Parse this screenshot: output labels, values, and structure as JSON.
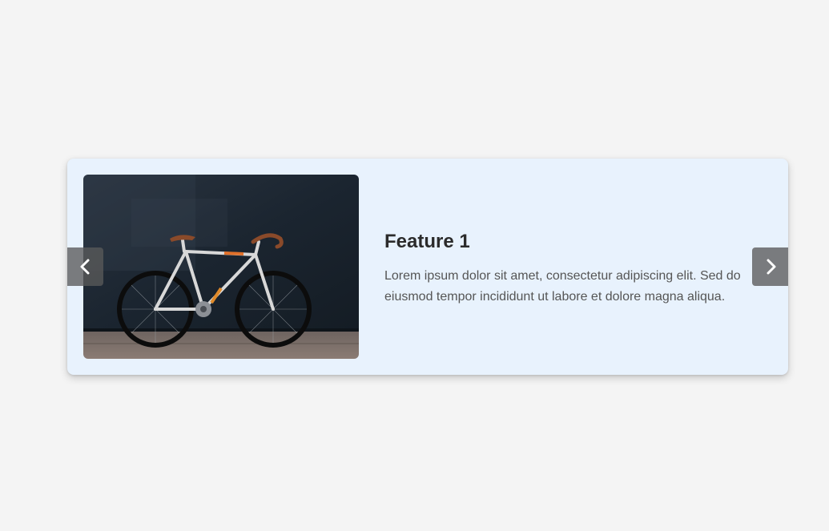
{
  "slides": [
    {
      "title": "Feature 1",
      "description": "Lorem ipsum dolor sit amet, consectetur adipiscing elit. Sed do eiusmod tempor incididunt ut labore et dolore magna aliqua.",
      "image": "bicycle-photo"
    }
  ],
  "nav": {
    "prev_icon": "chevron-left-icon",
    "next_icon": "chevron-right-icon"
  },
  "colors": {
    "page_background": "#f4f4f4",
    "card_background": "#e8f2fd",
    "title": "#2b2b2b",
    "text": "#555555",
    "nav_button": "#5a5a5a"
  }
}
